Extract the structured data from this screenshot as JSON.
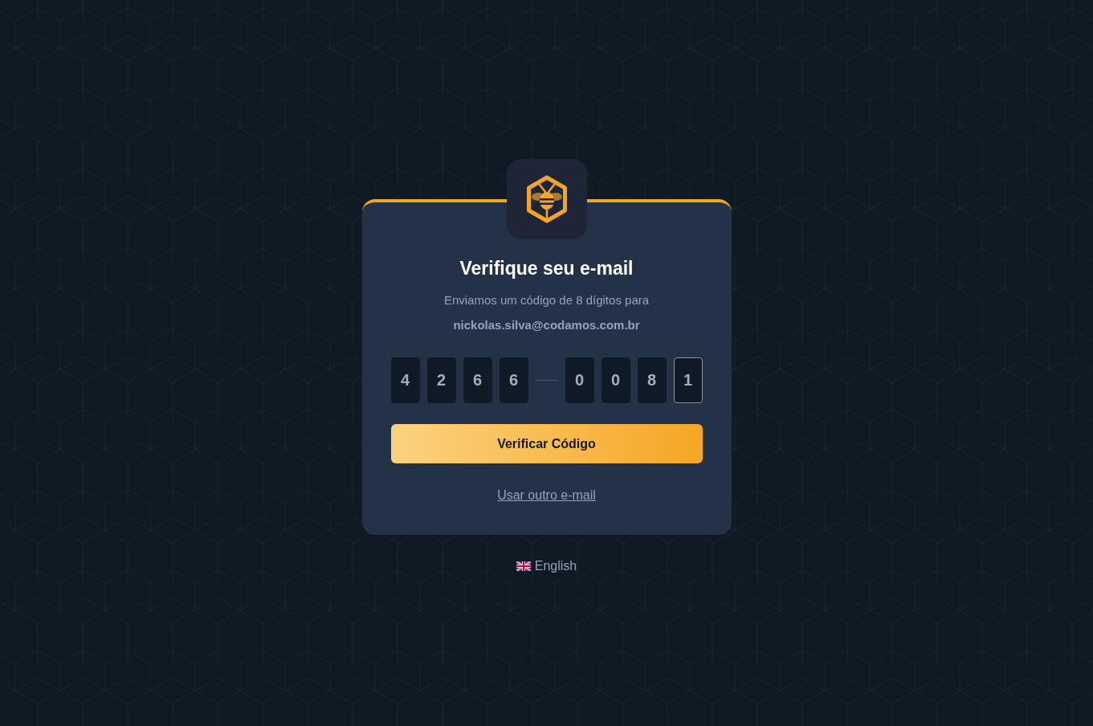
{
  "verification": {
    "title": "Verifique seu e-mail",
    "subtitle": "Enviamos um código de 8 dígitos para",
    "email": "nickolas.silva@codamos.com.br",
    "code_groups": [
      [
        {
          "value": "4",
          "focused": false
        },
        {
          "value": "2",
          "focused": false
        },
        {
          "value": "6",
          "focused": false
        },
        {
          "value": "6",
          "focused": false
        }
      ],
      [
        {
          "value": "0",
          "focused": false
        },
        {
          "value": "0",
          "focused": false
        },
        {
          "value": "8",
          "focused": false
        },
        {
          "value": "1",
          "focused": true
        }
      ]
    ],
    "submit_button": "Verificar Código",
    "other_email_link": "Usar outro e-mail"
  },
  "language": {
    "label": "English"
  }
}
